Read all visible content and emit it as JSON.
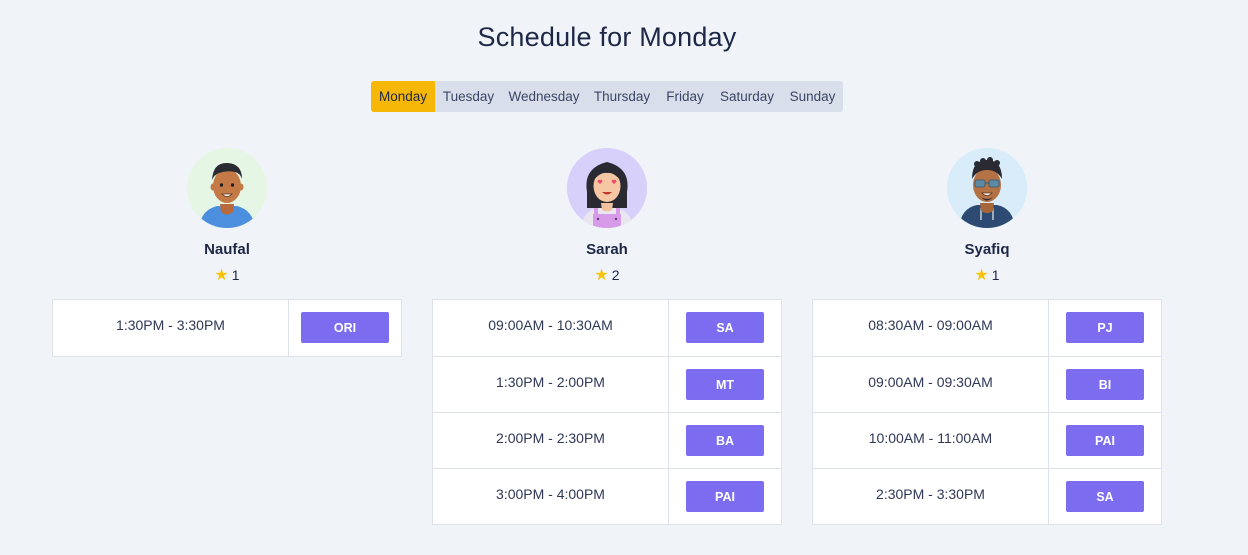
{
  "page": {
    "title": "Schedule for Monday"
  },
  "days": [
    "Monday",
    "Tuesday",
    "Wednesday",
    "Thursday",
    "Friday",
    "Saturday",
    "Sunday"
  ],
  "active_day": "Monday",
  "teachers": [
    {
      "name": "Naufal",
      "rating": "1",
      "avatar_icon": "male-avatar-icon",
      "avatar_bg": "#e5f7e4",
      "slots": [
        {
          "time": "1:30PM - 3:30PM",
          "subject": "ORI"
        }
      ]
    },
    {
      "name": "Sarah",
      "rating": "2",
      "avatar_icon": "female-avatar-icon",
      "avatar_bg": "#d6d0fb",
      "slots": [
        {
          "time": "09:00AM - 10:30AM",
          "subject": "SA"
        },
        {
          "time": "1:30PM - 2:00PM",
          "subject": "MT"
        },
        {
          "time": "2:00PM - 2:30PM",
          "subject": "BA"
        },
        {
          "time": "3:00PM - 4:00PM",
          "subject": "PAI"
        }
      ]
    },
    {
      "name": "Syafiq",
      "rating": "1",
      "avatar_icon": "male-glasses-avatar-icon",
      "avatar_bg": "#d8edf9",
      "slots": [
        {
          "time": "08:30AM - 09:00AM",
          "subject": "PJ"
        },
        {
          "time": "09:00AM - 09:30AM",
          "subject": "BI"
        },
        {
          "time": "10:00AM - 11:00AM",
          "subject": "PAI"
        },
        {
          "time": "2:30PM - 3:30PM",
          "subject": "SA"
        }
      ]
    }
  ],
  "colors": {
    "accent_active_day": "#f6b706",
    "subject_button": "#7b6cf0",
    "star": "#f6c40a"
  }
}
